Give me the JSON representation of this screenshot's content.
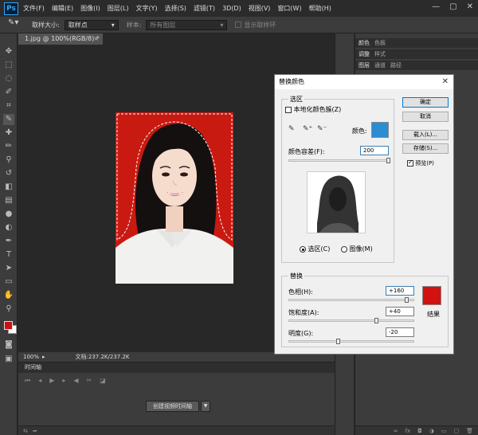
{
  "app": {
    "logo": "Ps",
    "menu": [
      "文件(F)",
      "编辑(E)",
      "图像(I)",
      "图层(L)",
      "文字(Y)",
      "选择(S)",
      "滤镜(T)",
      "3D(D)",
      "视图(V)",
      "窗口(W)",
      "帮助(H)"
    ]
  },
  "options": {
    "sample_size_label": "取样大小:",
    "sample_size_value": "取样点",
    "sample_label": "样本:",
    "sample_value": "所有图层",
    "show_ring_label": "显示取样环"
  },
  "document": {
    "tab_label": "1.jpg @ 100%(RGB/8) *",
    "zoom": "100%",
    "doc_info": "文档:237.2K/237.2K"
  },
  "timeline": {
    "title": "时间轴",
    "create_button": "创建视频时间轴"
  },
  "panels": {
    "row1": [
      "颜色",
      "色板"
    ],
    "row2": [
      "调整",
      "样式"
    ],
    "row3": [
      "图层",
      "通道",
      "路径"
    ]
  },
  "dialog": {
    "title": "替换颜色",
    "selection_legend": "选区",
    "localized_label": "本地化颜色簇(Z)",
    "color_label": "颜色:",
    "fuzziness_label": "颜色容差(F):",
    "fuzziness_value": "200",
    "radio_selection": "选区(C)",
    "radio_image": "图像(M)",
    "replace_legend": "替换",
    "hue_label": "色相(H):",
    "hue_value": "+160",
    "saturation_label": "饱和度(A):",
    "saturation_value": "+40",
    "lightness_label": "明度(G):",
    "lightness_value": "-20",
    "result_label": "结果",
    "buttons": {
      "ok": "确定",
      "cancel": "取消",
      "load": "载入(L)...",
      "save": "存储(S)...",
      "preview": "预览(P)"
    },
    "colors": {
      "picked": "#2b8dd3",
      "result": "#d21111"
    },
    "levels": {
      "fuzziness_fraction": 1.0,
      "hue_fraction": 0.94,
      "saturation_fraction": 0.7,
      "lightness_fraction": 0.4
    }
  }
}
